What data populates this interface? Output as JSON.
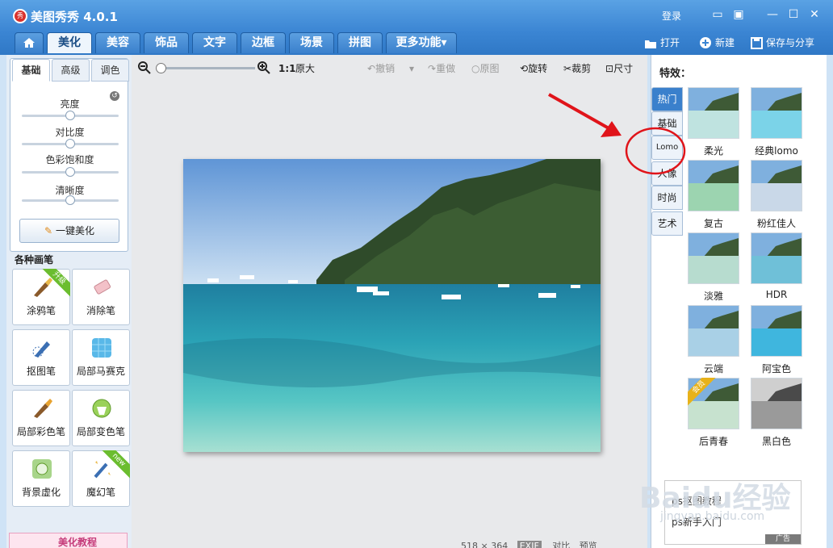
{
  "app": {
    "title": "美图秀秀 4.0.1",
    "logo_text": "秀",
    "login": "登录"
  },
  "tabs": [
    {
      "label": "美化"
    },
    {
      "label": "美容"
    },
    {
      "label": "饰品"
    },
    {
      "label": "文字"
    },
    {
      "label": "边框"
    },
    {
      "label": "场景"
    },
    {
      "label": "拼图"
    },
    {
      "label": "更多功能▾"
    }
  ],
  "top_actions": {
    "open": "打开",
    "new": "新建",
    "save": "保存与分享"
  },
  "left": {
    "tabs": [
      "基础",
      "高级",
      "调色"
    ],
    "sliders": [
      {
        "label": "亮度",
        "value": 0.5
      },
      {
        "label": "对比度",
        "value": 0.5
      },
      {
        "label": "色彩饱和度",
        "value": 0.5
      },
      {
        "label": "清晰度",
        "value": 0.5
      }
    ],
    "one_click": "一键美化",
    "brushes_title": "各种画笔",
    "brushes": [
      {
        "label": "涂鸦笔",
        "badge": "升级"
      },
      {
        "label": "消除笔",
        "badge": ""
      },
      {
        "label": "抠图笔",
        "badge": ""
      },
      {
        "label": "局部马赛克",
        "badge": ""
      },
      {
        "label": "局部彩色笔",
        "badge": ""
      },
      {
        "label": "局部变色笔",
        "badge": ""
      },
      {
        "label": "背景虚化",
        "badge": ""
      },
      {
        "label": "魔幻笔",
        "badge": "new"
      }
    ],
    "tutorial": "美化教程"
  },
  "toolbar": {
    "zoom_ratio": "1:1",
    "original_size": "原大",
    "undo": "撤销",
    "redo": "重做",
    "original": "原图",
    "rotate": "旋转",
    "crop": "裁剪",
    "resize": "尺寸"
  },
  "canvas": {
    "size_w": "518",
    "size_x": "×",
    "size_h": "364",
    "exif": "EXIF",
    "compare": "对比",
    "preview": "预览"
  },
  "effects": {
    "title": "特效：",
    "categories": [
      "热门",
      "基础",
      "Lomo",
      "人像",
      "时尚",
      "艺术"
    ],
    "active_category": "热门",
    "items": [
      {
        "label": "柔光",
        "badge": ""
      },
      {
        "label": "经典lomo",
        "badge": ""
      },
      {
        "label": "复古",
        "badge": ""
      },
      {
        "label": "粉红佳人",
        "badge": ""
      },
      {
        "label": "淡雅",
        "badge": ""
      },
      {
        "label": "HDR",
        "badge": ""
      },
      {
        "label": "云端",
        "badge": ""
      },
      {
        "label": "阿宝色",
        "badge": ""
      },
      {
        "label": "后青春",
        "badge": "会员"
      },
      {
        "label": "黑白色",
        "badge": ""
      }
    ]
  },
  "ad": {
    "line1": "ps抠图教程",
    "line2": "ps新手入门",
    "tag": "广告"
  },
  "watermark": {
    "line1": "Baidu经验",
    "line2": "jingyan.baidu.com"
  },
  "colors": {
    "titlebar": "#3b85d3",
    "annotation_red": "#e0141a",
    "tab_active_text": "#1a4d85"
  }
}
